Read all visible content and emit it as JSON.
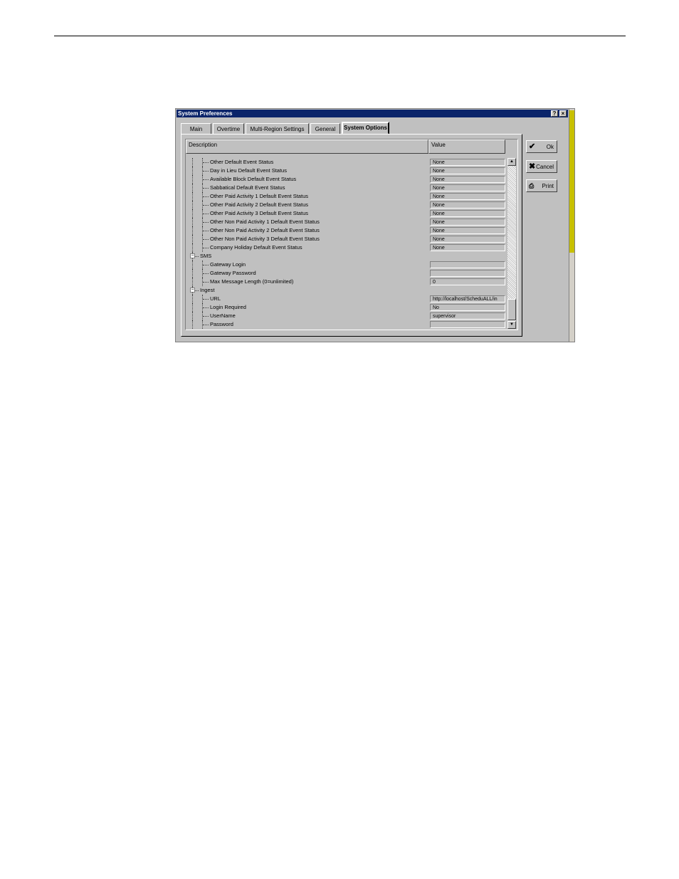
{
  "window": {
    "title": "System Preferences",
    "help_label": "?",
    "close_label": "×"
  },
  "tabs": [
    {
      "label": "Main",
      "active": false
    },
    {
      "label": "Overtime",
      "active": false
    },
    {
      "label": "Multi-Region Settings",
      "active": false
    },
    {
      "label": "General",
      "active": false
    },
    {
      "label": "System Options",
      "active": true
    }
  ],
  "grid": {
    "columns": [
      "Description",
      "Value"
    ],
    "rows": [
      {
        "label": "Other Default Event Status",
        "value": "None",
        "level": 2
      },
      {
        "label": "Day in Lieu Default Event Status",
        "value": "None",
        "level": 2
      },
      {
        "label": "Available Block Default Event Status",
        "value": "None",
        "level": 2
      },
      {
        "label": "Sabbatical Default Event Status",
        "value": "None",
        "level": 2
      },
      {
        "label": "Other Paid Activity 1 Default Event Status",
        "value": "None",
        "level": 2
      },
      {
        "label": "Other Paid Activity 2 Default Event Status",
        "value": "None",
        "level": 2
      },
      {
        "label": "Other Paid Activity 3 Default Event Status",
        "value": "None",
        "level": 2
      },
      {
        "label": "Other Non Paid Activity 1 Default Event Status",
        "value": "None",
        "level": 2
      },
      {
        "label": "Other Non Paid Activity 2 Default Event Status",
        "value": "None",
        "level": 2
      },
      {
        "label": "Other Non Paid Activity 3 Default Event Status",
        "value": "None",
        "level": 2
      },
      {
        "label": "Company Holiday Default Event Status",
        "value": "None",
        "level": 2
      },
      {
        "label": "SMS",
        "value": null,
        "level": 1,
        "toggle": "−"
      },
      {
        "label": "Gateway Login",
        "value": "",
        "level": 2
      },
      {
        "label": "Gateway Password",
        "value": "",
        "level": 2
      },
      {
        "label": "Max Message Length (0=unlimited)",
        "value": "0",
        "level": 2
      },
      {
        "label": "Ingest",
        "value": null,
        "level": 1,
        "toggle": "−"
      },
      {
        "label": "URL",
        "value": "http://localhost/ScheduALL/in",
        "level": 2
      },
      {
        "label": "Login Required",
        "value": "No",
        "level": 2
      },
      {
        "label": "UserName",
        "value": "supervisor",
        "level": 2
      },
      {
        "label": "Password",
        "value": "",
        "level": 2
      }
    ]
  },
  "buttons": {
    "ok": {
      "label": "Ok",
      "icon": "checkmark-icon"
    },
    "cancel": {
      "label": "Cancel",
      "icon": "x-icon"
    },
    "print": {
      "label": "Print",
      "icon": "print-icon"
    }
  },
  "scrollbar": {
    "up": "▲",
    "down": "▼"
  }
}
